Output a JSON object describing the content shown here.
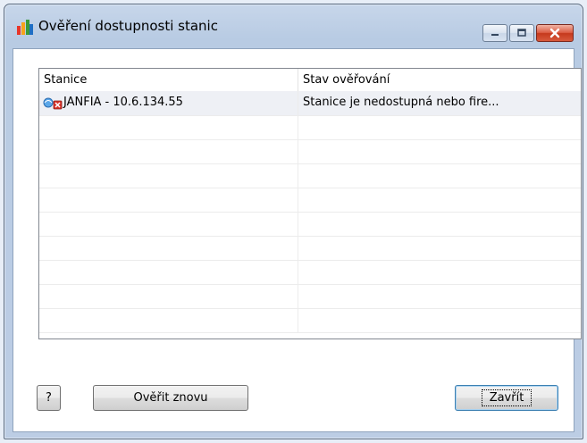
{
  "window": {
    "title": "Ověření dostupnosti stanic",
    "icon": "avg-logo-icon"
  },
  "caption_buttons": [
    "minimize-icon",
    "maximize-icon",
    "close-icon"
  ],
  "listview": {
    "columns": [
      "Stanice",
      "Stav ověřování"
    ],
    "rows": [
      {
        "station": "JANFIA - 10.6.134.55",
        "status": "Stanice je nedostupná nebo fire...",
        "icon": "station-unreachable-icon",
        "selected": true
      }
    ]
  },
  "buttons": {
    "help": "?",
    "retry": "Ověřit znovu",
    "close": "Zavřít"
  }
}
